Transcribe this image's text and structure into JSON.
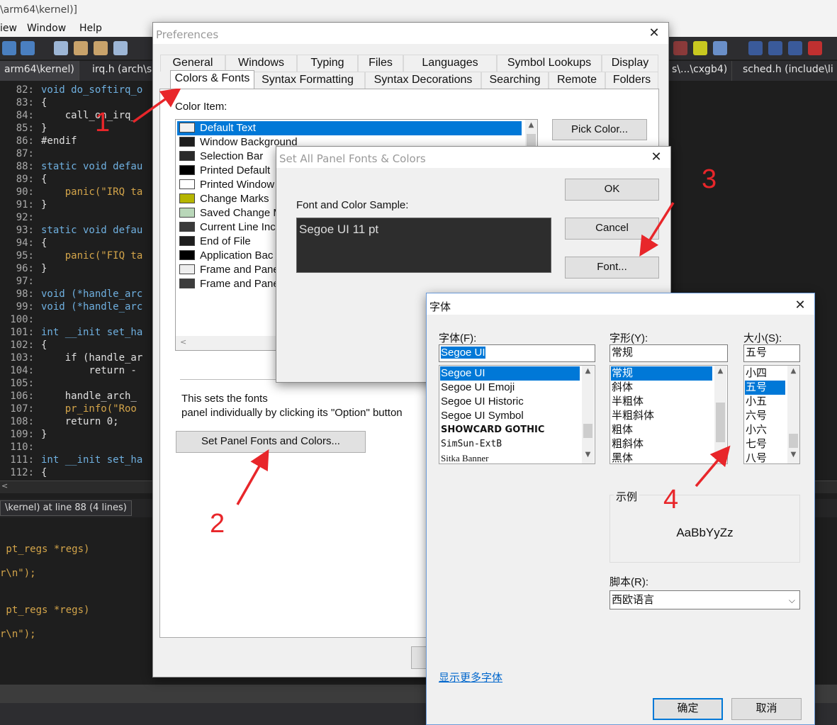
{
  "ide": {
    "title_fragment": "\\arm64\\kernel)]",
    "menu": [
      "iew",
      "Window",
      "Help"
    ],
    "tabs": [
      {
        "label": "arm64\\kernel)",
        "active": true
      },
      {
        "label": "irq.h (arch\\s"
      },
      {
        "label": "s\\...\\cxgb4)"
      },
      {
        "label": "sched.h (include\\li"
      }
    ],
    "code_lines": [
      {
        "n": "82:",
        "text": "void do_softirq_o"
      },
      {
        "n": "83:",
        "text": "{"
      },
      {
        "n": "84:",
        "text": "    call_on_irq_"
      },
      {
        "n": "85:",
        "text": "}"
      },
      {
        "n": "86:",
        "text": "#endif"
      },
      {
        "n": "87:",
        "text": ""
      },
      {
        "n": "88:",
        "text": "static void defau"
      },
      {
        "n": "89:",
        "text": "{"
      },
      {
        "n": "90:",
        "text": "    panic(\"IRQ ta"
      },
      {
        "n": "91:",
        "text": "}"
      },
      {
        "n": "92:",
        "text": ""
      },
      {
        "n": "93:",
        "text": "static void defau"
      },
      {
        "n": "94:",
        "text": "{"
      },
      {
        "n": "95:",
        "text": "    panic(\"FIQ ta"
      },
      {
        "n": "96:",
        "text": "}"
      },
      {
        "n": "97:",
        "text": ""
      },
      {
        "n": "98:",
        "text": "void (*handle_arc"
      },
      {
        "n": "99:",
        "text": "void (*handle_arc"
      },
      {
        "n": "100:",
        "text": ""
      },
      {
        "n": "101:",
        "text": "int __init set_ha"
      },
      {
        "n": "102:",
        "text": "{"
      },
      {
        "n": "103:",
        "text": "    if (handle_ar"
      },
      {
        "n": "104:",
        "text": "        return -"
      },
      {
        "n": "105:",
        "text": ""
      },
      {
        "n": "106:",
        "text": "    handle_arch_"
      },
      {
        "n": "107:",
        "text": "    pr_info(\"Roo"
      },
      {
        "n": "108:",
        "text": "    return 0;"
      },
      {
        "n": "109:",
        "text": "}"
      },
      {
        "n": "110:",
        "text": ""
      },
      {
        "n": "111:",
        "text": "int __init set_ha"
      },
      {
        "n": "112:",
        "text": "{"
      }
    ],
    "reference_tab": "\\kernel) at line 88 (4 lines)",
    "reference_lines": [
      {
        "text": " pt_regs *regs)"
      },
      {
        "text": "r\\n\");"
      },
      {
        "text": " pt_regs *regs)"
      },
      {
        "text": "r\\n\");"
      }
    ]
  },
  "preferences": {
    "title": "Preferences",
    "tabs_row1": [
      "General",
      "Windows",
      "Typing",
      "Files",
      "Languages",
      "Symbol Lookups",
      "Display"
    ],
    "tabs_row2": [
      "Colors & Fonts",
      "Syntax Formatting",
      "Syntax Decorations",
      "Searching",
      "Remote",
      "Folders"
    ],
    "color_item_label": "Color Item:",
    "pick_color": "Pick Color...",
    "color_items": [
      {
        "label": "Default Text",
        "swatch": "#f0f0f0",
        "selected": true
      },
      {
        "label": "Window Background",
        "swatch": "#1e1e1e"
      },
      {
        "label": "Selection Bar",
        "swatch": "#2a2a2a"
      },
      {
        "label": "Printed Default",
        "swatch": "#000000"
      },
      {
        "label": "Printed Window",
        "swatch": "#ffffff"
      },
      {
        "label": "Change Marks",
        "swatch": "#b5b500"
      },
      {
        "label": "Saved Change M",
        "swatch": "#b9d7b9"
      },
      {
        "label": "Current Line Inc",
        "swatch": "#3a3a3a"
      },
      {
        "label": "End of File",
        "swatch": "#1e1e1e"
      },
      {
        "label": "Application Bac",
        "swatch": "#000000"
      },
      {
        "label": "Frame and Pane",
        "swatch": "#eeeeee"
      },
      {
        "label": "Frame and Pane",
        "swatch": "#3c3c3c"
      }
    ],
    "info_line1": "This sets the fonts",
    "info_line2": "panel individually by clicking its \"Option\" button",
    "set_panel_button": "Set Panel Fonts and Colors..."
  },
  "set_all": {
    "title": "Set All Panel Fonts & Colors",
    "sample_label": "Font and Color Sample:",
    "sample_text": "Segoe UI 11 pt",
    "ok": "OK",
    "cancel": "Cancel",
    "font": "Font..."
  },
  "font_dialog": {
    "title": "字体",
    "font_label": "字体(F):",
    "font_value": "Segoe UI",
    "fonts": [
      "Segoe UI",
      "Segoe UI Emoji",
      "Segoe UI Historic",
      "Segoe UI Symbol",
      "SHOWCARD GOTHIC",
      "SimSun-ExtB",
      "Sitka Banner"
    ],
    "style_label": "字形(Y):",
    "style_value": "常规",
    "styles": [
      "常规",
      "斜体",
      "半粗体",
      "半粗斜体",
      "粗体",
      "粗斜体",
      "黑体"
    ],
    "size_label": "大小(S):",
    "size_value": "五号",
    "sizes": [
      "小四",
      "五号",
      "小五",
      "六号",
      "小六",
      "七号",
      "八号"
    ],
    "sample_group": "示例",
    "sample_text": "AaBbYyZz",
    "script_label": "脚本(R):",
    "script_value": "西欧语言",
    "more_fonts": "显示更多字体",
    "ok": "确定",
    "cancel": "取消"
  },
  "annotations": [
    "1",
    "2",
    "3",
    "4"
  ],
  "colors": {
    "annotation": "#e8262a",
    "selection": "#0078d7",
    "ide_bg": "#1e1e1e"
  }
}
